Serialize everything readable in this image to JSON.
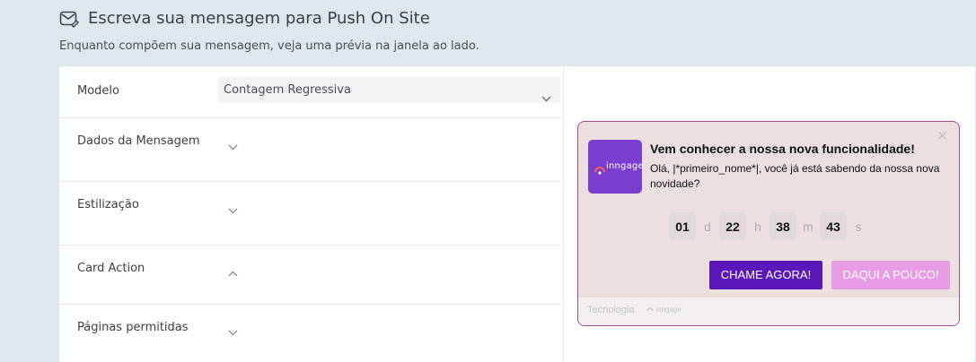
{
  "header": {
    "title": "Escreva sua mensagem para Push On Site",
    "subtitle": "Enquanto compõem sua mensagem, veja uma prévia na janela ao lado."
  },
  "form": {
    "modelo_label": "Modelo",
    "modelo_value": "Contagem Regressiva",
    "sections": [
      {
        "label": "Dados da Mensagem",
        "expanded": false
      },
      {
        "label": "Estilização",
        "expanded": false
      },
      {
        "label": "Card Action",
        "expanded": true
      },
      {
        "label": "Páginas permitidas",
        "expanded": false
      }
    ]
  },
  "preview": {
    "close": "×",
    "logo_text": "inngage",
    "title": "Vem conhecer a nossa nova funcionalidade!",
    "body": "Olá, |*primeiro_nome*|, você já está sabendo da nossa nova novidade?",
    "countdown": {
      "days": "01",
      "days_unit": "d",
      "hours": "22",
      "hours_unit": "h",
      "minutes": "38",
      "minutes_unit": "m",
      "seconds": "43",
      "seconds_unit": "s"
    },
    "primary_button": "CHAME AGORA!",
    "secondary_button": "DAQUI A POUCO!",
    "footer_text": "Tecnologia",
    "footer_brand": "inngage"
  },
  "colors": {
    "background": "#dde7ec",
    "card_border": "#a24a98",
    "card_bg": "#ecdfe0",
    "logo_bg": "#7a3fcf",
    "primary_button": "#5a18b9",
    "secondary_button": "#e99ce6"
  }
}
